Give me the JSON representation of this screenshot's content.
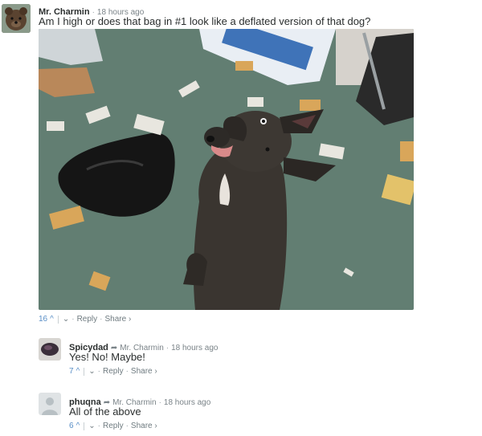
{
  "comments": [
    {
      "username": "Mr. Charmin",
      "timestamp": "18 hours ago",
      "text": "Am I high or does that bag in #1 look like a deflated version of that dog?",
      "votes": "16",
      "reply_label": "Reply",
      "share_label": "Share ›"
    },
    {
      "username": "Spicydad",
      "reply_to": "Mr. Charmin",
      "timestamp": "18 hours ago",
      "text": "Yes! No! Maybe!",
      "votes": "7",
      "reply_label": "Reply",
      "share_label": "Share ›"
    },
    {
      "username": "phuqna",
      "reply_to": "Mr. Charmin",
      "timestamp": "18 hours ago",
      "text": "All of the above",
      "votes": "6",
      "reply_label": "Reply",
      "share_label": "Share ›"
    }
  ],
  "icons": {
    "upvote": "chevron-up-icon",
    "downvote": "chevron-down-icon",
    "reply_arrow": "reply-arrow-icon"
  },
  "colors": {
    "vote_blue": "#5a8fc7",
    "meta_gray": "#7a8388",
    "carpet_green": "#5f7b6e"
  }
}
